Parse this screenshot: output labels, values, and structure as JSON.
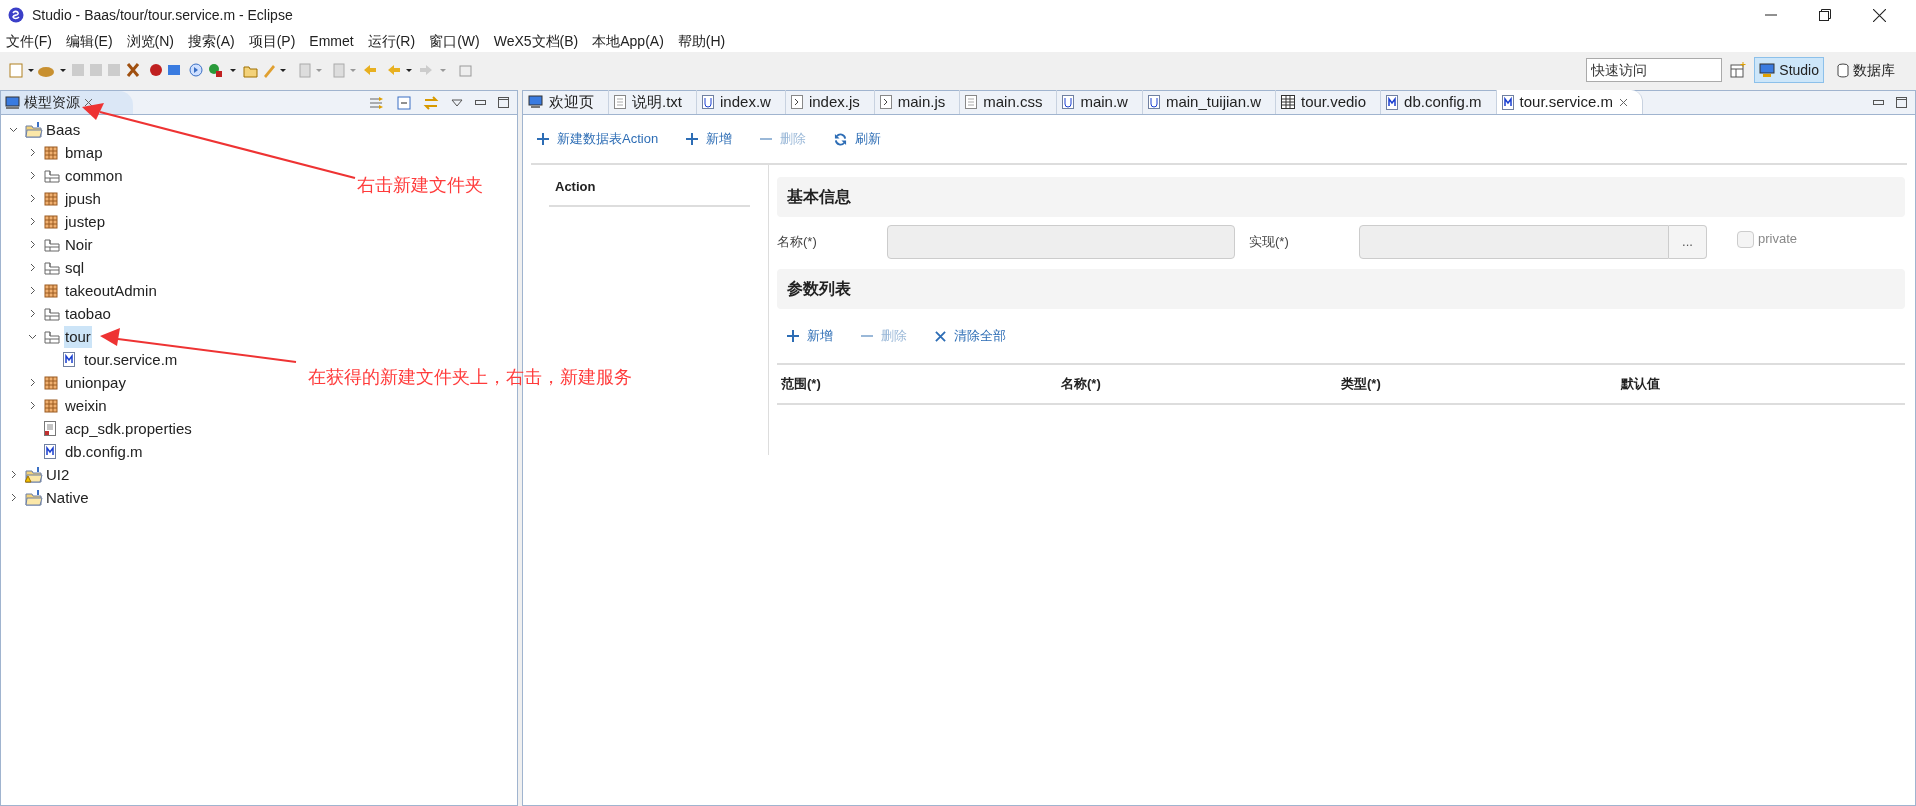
{
  "window": {
    "title": "Studio - Baas/tour/tour.service.m - Eclipse"
  },
  "menu": [
    "文件(F)",
    "编辑(E)",
    "浏览(N)",
    "搜索(A)",
    "项目(P)",
    "Emmet",
    "运行(R)",
    "窗口(W)",
    "WeX5文档(B)",
    "本地App(A)",
    "帮助(H)"
  ],
  "quick_access": {
    "placeholder": "快速访问"
  },
  "perspectives": [
    {
      "label": "Studio",
      "selected": true
    },
    {
      "label": "数据库",
      "selected": false
    }
  ],
  "left_panel": {
    "title": "模型资源",
    "tree": [
      {
        "label": "Baas",
        "kind": "project",
        "expanded": true,
        "selected": false,
        "children": [
          {
            "label": "bmap",
            "kind": "package",
            "expanded": false,
            "selected": false
          },
          {
            "label": "common",
            "kind": "folder",
            "expanded": false,
            "selected": false
          },
          {
            "label": "jpush",
            "kind": "package",
            "expanded": false,
            "selected": false
          },
          {
            "label": "justep",
            "kind": "package",
            "expanded": false,
            "selected": false
          },
          {
            "label": "Noir",
            "kind": "folder",
            "expanded": false,
            "selected": false
          },
          {
            "label": "sql",
            "kind": "folder",
            "expanded": false,
            "selected": false
          },
          {
            "label": "takeoutAdmin",
            "kind": "package",
            "expanded": false,
            "selected": false
          },
          {
            "label": "taobao",
            "kind": "folder",
            "expanded": false,
            "selected": false
          },
          {
            "label": "tour",
            "kind": "folder",
            "expanded": true,
            "selected": true,
            "children": [
              {
                "label": "tour.service.m",
                "kind": "model",
                "selected": false
              }
            ]
          },
          {
            "label": "unionpay",
            "kind": "package",
            "expanded": false,
            "selected": false
          },
          {
            "label": "weixin",
            "kind": "package",
            "expanded": false,
            "selected": false
          },
          {
            "label": "acp_sdk.properties",
            "kind": "properties",
            "selected": false
          },
          {
            "label": "db.config.m",
            "kind": "model",
            "selected": false
          }
        ]
      },
      {
        "label": "UI2",
        "kind": "project-warning",
        "expanded": false,
        "selected": false
      },
      {
        "label": "Native",
        "kind": "project",
        "expanded": false,
        "selected": false
      }
    ]
  },
  "editor": {
    "tabs": [
      {
        "label": "欢迎页",
        "kind": "welcome",
        "selected": false
      },
      {
        "label": "说明.txt",
        "kind": "text",
        "selected": false
      },
      {
        "label": "index.w",
        "kind": "w",
        "selected": false
      },
      {
        "label": "index.js",
        "kind": "js",
        "selected": false
      },
      {
        "label": "main.js",
        "kind": "js",
        "selected": false
      },
      {
        "label": "main.css",
        "kind": "text",
        "selected": false
      },
      {
        "label": "main.w",
        "kind": "w",
        "selected": false
      },
      {
        "label": "main_tuijian.w",
        "kind": "w",
        "selected": false
      },
      {
        "label": "tour.vedio",
        "kind": "table",
        "selected": false
      },
      {
        "label": "db.config.m",
        "kind": "model",
        "selected": false
      },
      {
        "label": "tour.service.m",
        "kind": "model",
        "selected": true
      }
    ],
    "toolbar": [
      {
        "label": "新建数据表Action",
        "kind": "add",
        "disabled": false
      },
      {
        "label": "新增",
        "kind": "add",
        "disabled": false
      },
      {
        "label": "删除",
        "kind": "remove",
        "disabled": true
      },
      {
        "label": "刷新",
        "kind": "refresh",
        "disabled": false
      }
    ],
    "action_list": {
      "header": "Action"
    },
    "basic_info": {
      "title": "基本信息",
      "name_label": "名称(*)",
      "impl_label": "实现(*)",
      "browse_button": "...",
      "private": {
        "label": "private",
        "checked": false,
        "disabled": true
      }
    },
    "params": {
      "title": "参数列表",
      "toolbar": [
        {
          "label": "新增",
          "kind": "add",
          "disabled": false
        },
        {
          "label": "删除",
          "kind": "remove",
          "disabled": true
        },
        {
          "label": "清除全部",
          "kind": "clear",
          "disabled": false
        }
      ],
      "columns": [
        "范围(*)",
        "名称(*)",
        "类型(*)",
        "默认值"
      ]
    }
  },
  "annotations": [
    {
      "text": "右击新建文件夹"
    },
    {
      "text": "在获得的新建文件夹上，右击，新建服务"
    }
  ]
}
